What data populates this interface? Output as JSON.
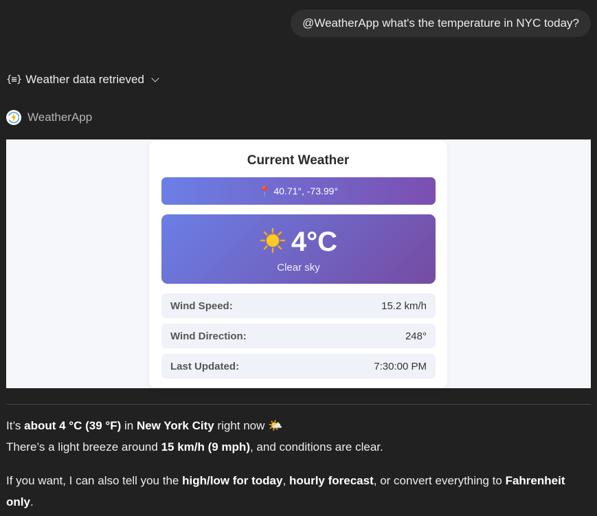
{
  "user_message": "@WeatherApp what's the temperature in NYC today?",
  "tool_call": {
    "icon": "braces-list-icon",
    "label": "Weather data retrieved"
  },
  "app": {
    "name": "WeatherApp",
    "icon": "lightning-logo-icon"
  },
  "widget": {
    "title": "Current Weather",
    "coordinates": "40.71°, -73.99°",
    "temperature": "4°C",
    "condition": "Clear sky",
    "rows": [
      {
        "label": "Wind Speed:",
        "value": "15.2 km/h"
      },
      {
        "label": "Wind Direction:",
        "value": "248°"
      },
      {
        "label": "Last Updated:",
        "value": "7:30:00 PM"
      }
    ]
  },
  "reply": {
    "p1": {
      "t1": "It’s ",
      "b1": "about 4 °C (39 °F)",
      "t2": " in ",
      "b2": "New York City",
      "t3": " right now ",
      "emoji": "🌤️"
    },
    "p2": {
      "t1": "There’s a light breeze around ",
      "b1": "15 km/h (9 mph)",
      "t2": ", and conditions are clear."
    },
    "p3": {
      "t1": "If you want, I can also tell you the ",
      "b1": "high/low for today",
      "t2": ", ",
      "b2": "hourly forecast",
      "t3": ", or convert everything to ",
      "b3": "Fahrenheit only",
      "t4": "."
    }
  }
}
